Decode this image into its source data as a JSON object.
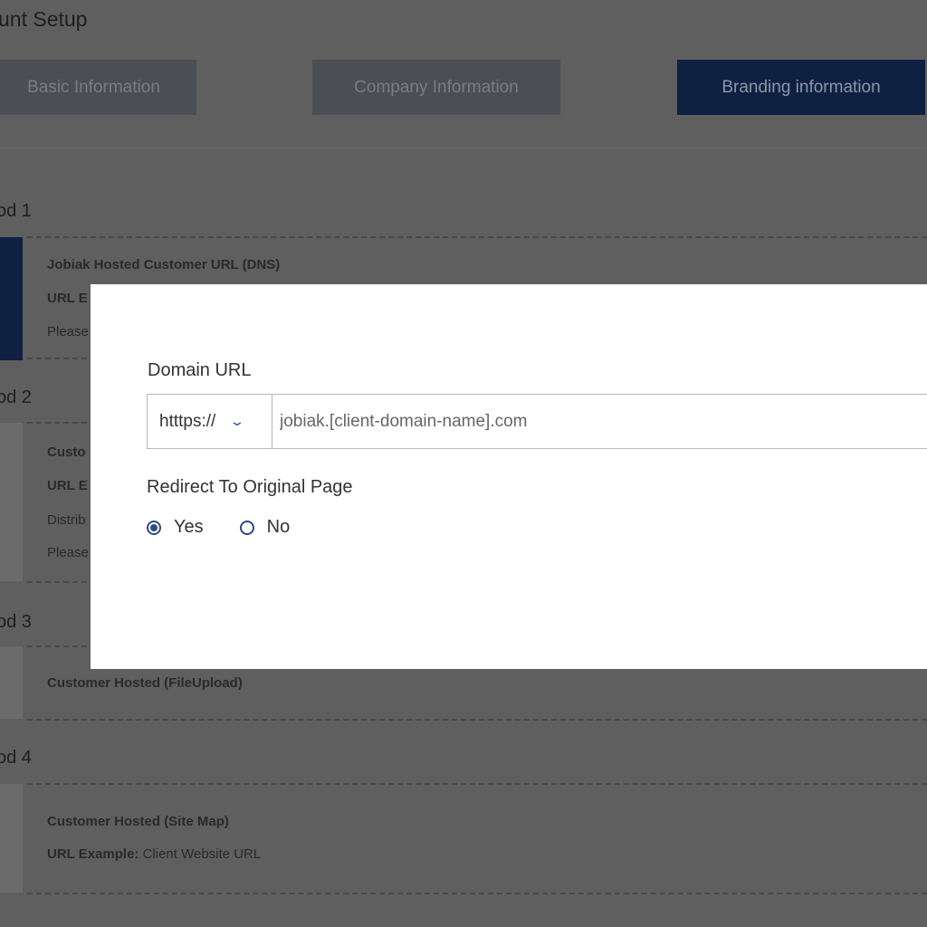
{
  "page": {
    "title": "unt Setup"
  },
  "tabs": [
    {
      "label": "Basic Information"
    },
    {
      "label": "Company Information"
    },
    {
      "label": "Branding information"
    }
  ],
  "methods": [
    {
      "title": "od 1",
      "lines": [
        {
          "text": "Jobiak Hosted Customer URL (DNS)"
        },
        {
          "text": "URL E"
        },
        {
          "text": "Please"
        }
      ]
    },
    {
      "title": "od 2",
      "lines": [
        {
          "text": "Custo"
        },
        {
          "text": "URL E"
        },
        {
          "text": "Distrib"
        },
        {
          "text": "Please"
        }
      ]
    },
    {
      "title": "od 3",
      "lines": [
        {
          "text": "Customer Hosted (FileUpload)"
        }
      ]
    },
    {
      "title": "od 4",
      "lines": [
        {
          "text": "Customer Hosted (Site Map)"
        },
        {
          "label": "URL Example:",
          "value": "Client Website URL"
        }
      ]
    }
  ],
  "modal": {
    "domain_label": "Domain URL",
    "protocol": "htttps://",
    "domain_value": "jobiak.[client-domain-name].com",
    "redirect_label": "Redirect To Original Page",
    "options": [
      {
        "label": "Yes",
        "checked": true
      },
      {
        "label": "No",
        "checked": false
      }
    ]
  },
  "colors": {
    "overlay": "#5f5f5f",
    "active_tab": "#0f2142",
    "accent": "#2c4a86"
  },
  "icons": {
    "protocol_dropdown": "chevron-down-icon"
  }
}
